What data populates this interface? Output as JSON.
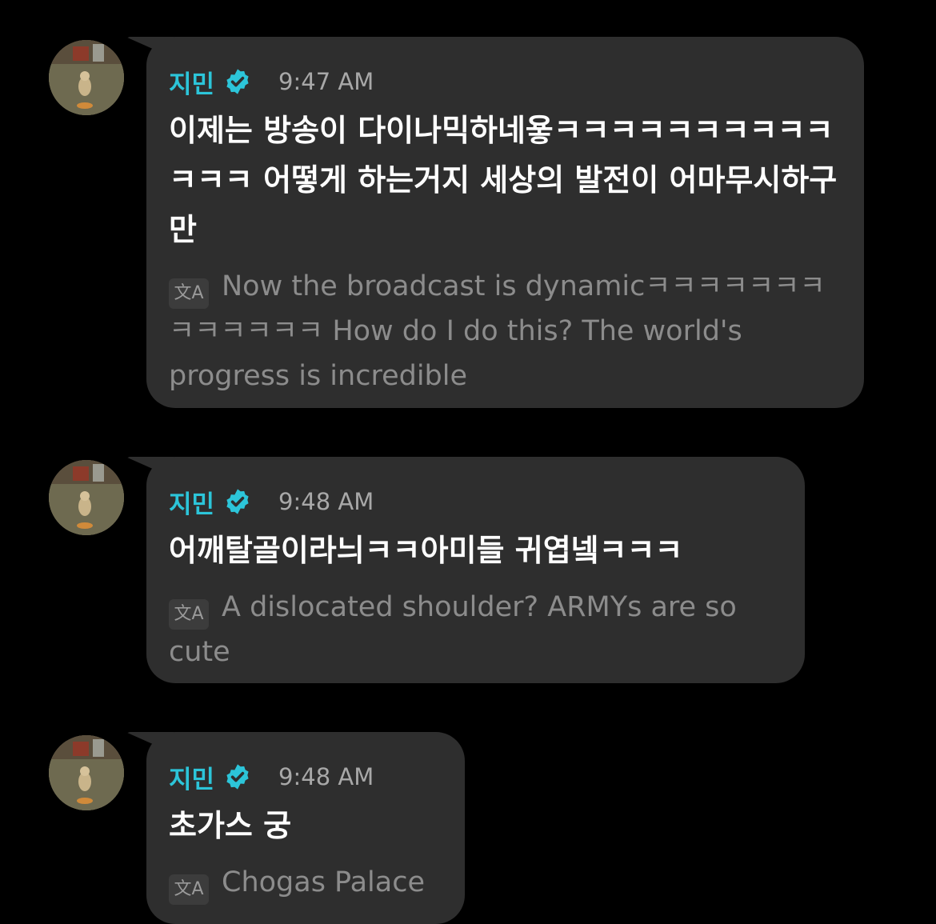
{
  "colors": {
    "background": "#000000",
    "bubble": "#2e2e2e",
    "name": "#2cc5d9",
    "time": "#a8a8a8",
    "translation": "#8c8c8c",
    "verified": "#2cc5d9"
  },
  "messages": [
    {
      "sender": "지민",
      "verified_icon": "verified-badge-icon",
      "time": "9:47 AM",
      "text": "이제는 방송이 다이나믹하네욯ㅋㅋㅋㅋㅋㅋㅋㅋㅋㅋㅋㅋㅋ 어떻게 하는거지 세상의 발전이 어마무시하구만",
      "translate_icon": "translate-icon",
      "translation": "Now the broadcast is dynamicㅋㅋㅋㅋㅋㅋㅋㅋㅋㅋㅋㅋㅋ How do I do this? The world's progress is incredible"
    },
    {
      "sender": "지민",
      "verified_icon": "verified-badge-icon",
      "time": "9:48 AM",
      "text": "어깨탈골이라늬ㅋㅋ아미들 귀엽넼ㅋㅋㅋ",
      "translate_icon": "translate-icon",
      "translation": "A dislocated shoulder? ARMYs are so cute"
    },
    {
      "sender": "지민",
      "verified_icon": "verified-badge-icon",
      "time": "9:48 AM",
      "text": "초가스 궁",
      "translate_icon": "translate-icon",
      "translation": "Chogas Palace"
    }
  ]
}
